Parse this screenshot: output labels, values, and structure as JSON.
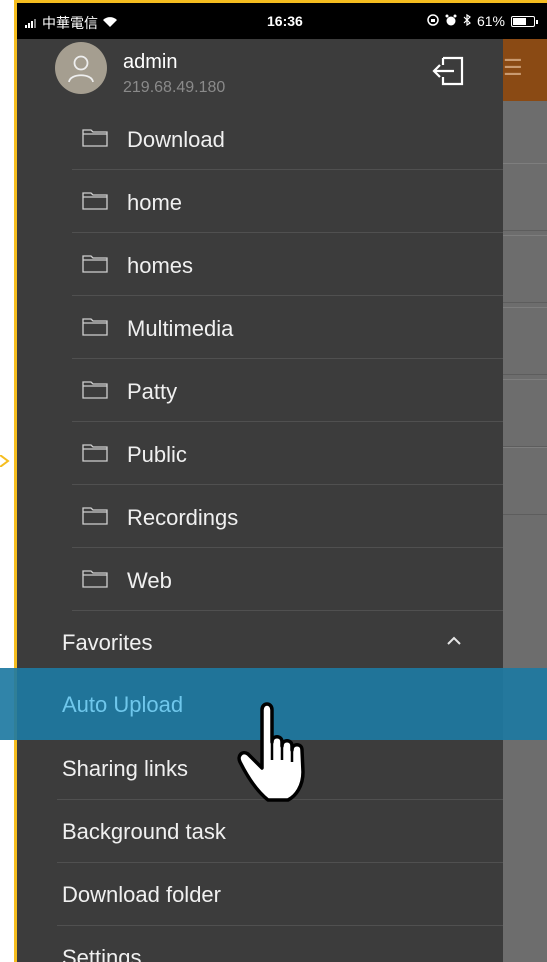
{
  "status_bar": {
    "carrier": "中華電信",
    "time": "16:36",
    "battery": "61%"
  },
  "user": {
    "name": "admin",
    "ip": "219.68.49.180"
  },
  "folders": [
    {
      "label": "Download"
    },
    {
      "label": "home"
    },
    {
      "label": "homes"
    },
    {
      "label": "Multimedia"
    },
    {
      "label": "Patty"
    },
    {
      "label": "Public"
    },
    {
      "label": "Recordings"
    },
    {
      "label": "Web"
    }
  ],
  "menu": {
    "favorites": "Favorites",
    "auto_upload": "Auto Upload",
    "sharing_links": "Sharing links",
    "background_task": "Background task",
    "download_folder": "Download folder",
    "settings": "Settings"
  },
  "colors": {
    "drawer_bg": "#3c3c3c",
    "highlight": "#1e7aa2",
    "highlight_text": "#6fc7ec",
    "header_brand": "#8a4a14",
    "frame_outline": "#f5bd1f"
  },
  "icons": {
    "folder": "folder-icon",
    "logout": "logout-icon",
    "avatar": "user-icon",
    "favorites_toggle": "chevron-up-icon",
    "pointer": "hand-pointer-icon"
  }
}
